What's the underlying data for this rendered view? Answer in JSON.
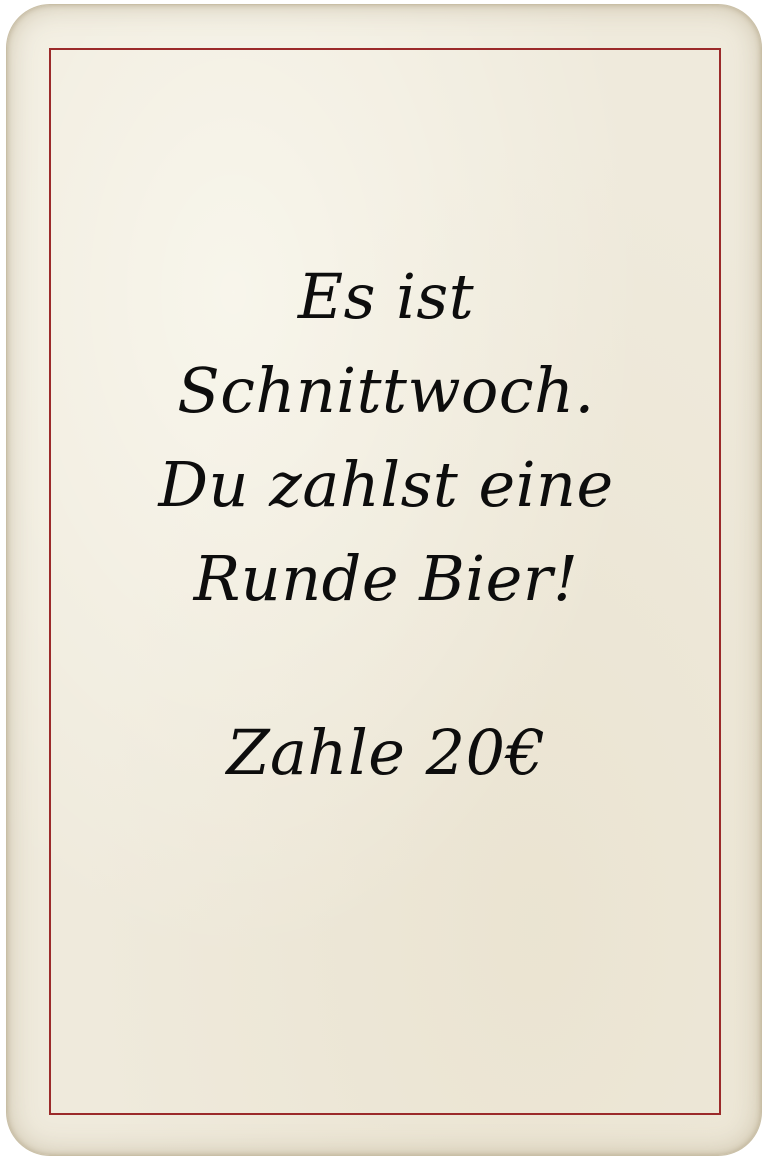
{
  "card": {
    "message_lines": [
      "Es ist",
      "Schnittwoch.",
      "Du zahlst eine",
      "Runde Bier!"
    ],
    "price": "Zahle 20€"
  },
  "colors": {
    "paper": "#efeadc",
    "frame": "#9b2a2a",
    "ink": "#0d0d0d"
  }
}
